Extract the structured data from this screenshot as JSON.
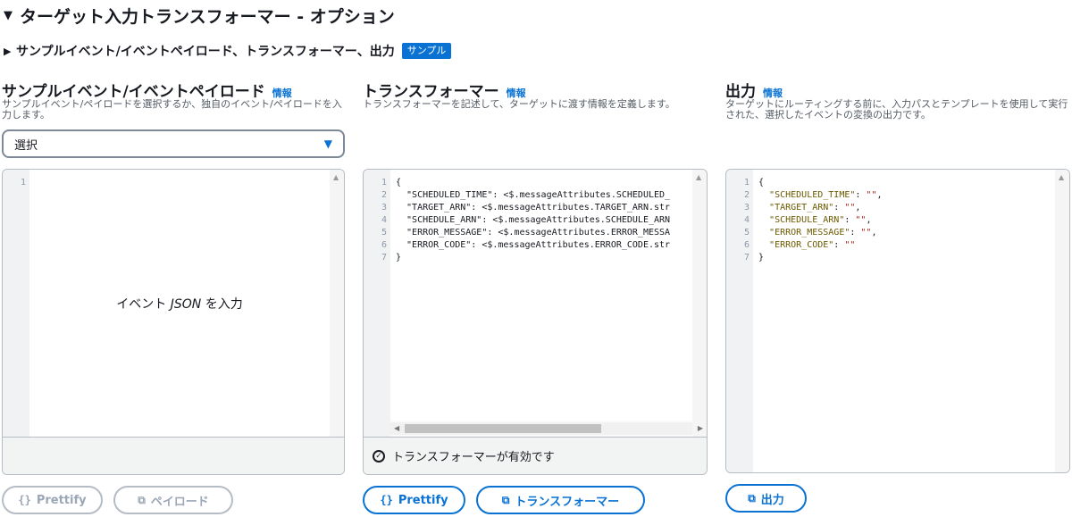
{
  "section": {
    "title": "ターゲット入力トランスフォーマー - オプション",
    "caret": "▼"
  },
  "subsection": {
    "title": "サンプルイベント/イベントペイロード、トランスフォーマー、出力",
    "caret": "▶",
    "badge": "サンプル"
  },
  "columns": {
    "payload": {
      "title": "サンプルイベント/イベントペイロード",
      "info": "情報",
      "desc": "サンプルイベント/ペイロードを選択するか、独自のイベント/ペイロードを入力します。",
      "select_value": "選択",
      "placeholder_pre": "イベント ",
      "placeholder_em": "JSON",
      "placeholder_post": " を入力",
      "line1": "1"
    },
    "transformer": {
      "title": "トランスフォーマー",
      "info": "情報",
      "desc": "トランスフォーマーを記述して、ターゲットに渡す情報を定義します。",
      "valid_text": "トランスフォーマーが有効です"
    },
    "output": {
      "title": "出力",
      "info": "情報",
      "desc": "ターゲットにルーティングする前に、入力パスとテンプレートを使用して実行された、選択したイベントの変換の出力です。"
    }
  },
  "transformer_code": [
    {
      "n": "1",
      "text": "{"
    },
    {
      "n": "2",
      "text": "  \"SCHEDULED_TIME\": <$.messageAttributes.SCHEDULED_"
    },
    {
      "n": "3",
      "text": "  \"TARGET_ARN\": <$.messageAttributes.TARGET_ARN.str"
    },
    {
      "n": "4",
      "text": "  \"SCHEDULE_ARN\": <$.messageAttributes.SCHEDULE_ARN"
    },
    {
      "n": "5",
      "text": "  \"ERROR_MESSAGE\": <$.messageAttributes.ERROR_MESSA"
    },
    {
      "n": "6",
      "text": "  \"ERROR_CODE\": <$.messageAttributes.ERROR_CODE.str"
    },
    {
      "n": "7",
      "text": "}"
    }
  ],
  "output_code": [
    {
      "n": "1",
      "pre": "{",
      "key": "",
      "sep": "",
      "val": "",
      "post": ""
    },
    {
      "n": "2",
      "pre": "  ",
      "key": "\"SCHEDULED_TIME\"",
      "sep": ": ",
      "val": "\"\"",
      "post": ","
    },
    {
      "n": "3",
      "pre": "  ",
      "key": "\"TARGET_ARN\"",
      "sep": ": ",
      "val": "\"\"",
      "post": ","
    },
    {
      "n": "4",
      "pre": "  ",
      "key": "\"SCHEDULE_ARN\"",
      "sep": ": ",
      "val": "\"\"",
      "post": ","
    },
    {
      "n": "5",
      "pre": "  ",
      "key": "\"ERROR_MESSAGE\"",
      "sep": ": ",
      "val": "\"\"",
      "post": ","
    },
    {
      "n": "6",
      "pre": "  ",
      "key": "\"ERROR_CODE\"",
      "sep": ": ",
      "val": "\"\"",
      "post": ""
    },
    {
      "n": "7",
      "pre": "}",
      "key": "",
      "sep": "",
      "val": "",
      "post": ""
    }
  ],
  "buttons": {
    "prettify1": {
      "icon": "{}",
      "label": "Prettify"
    },
    "payload": {
      "icon": "⧉",
      "label": "ペイロード"
    },
    "prettify2": {
      "icon": "{}",
      "label": "Prettify"
    },
    "transformer": {
      "icon": "⧉",
      "label": "トランスフォーマー"
    },
    "output": {
      "icon": "⧉",
      "label": "出力"
    }
  }
}
